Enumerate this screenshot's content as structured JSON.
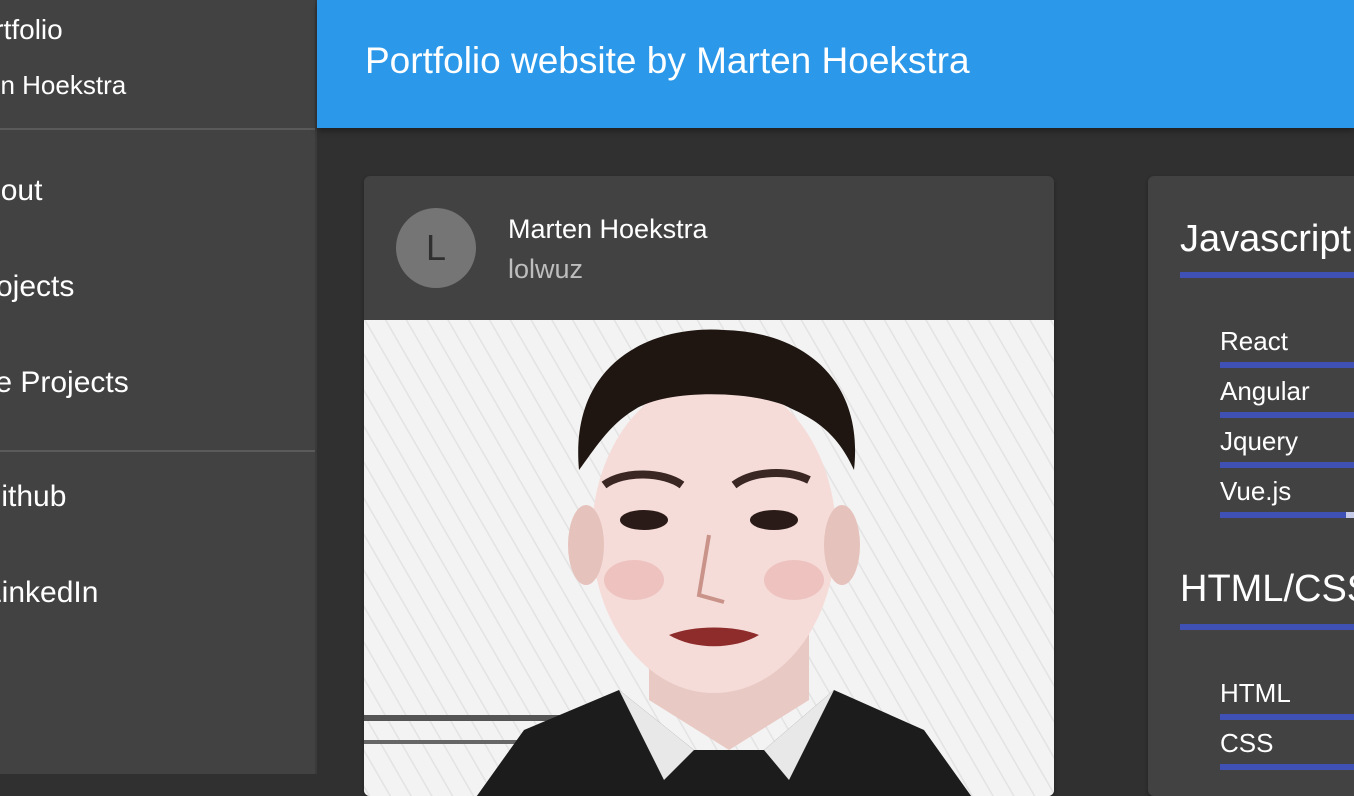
{
  "drawer": {
    "title": "Portfolio",
    "subtitle": "Marten Hoekstra",
    "items": [
      {
        "label": "About"
      },
      {
        "label": "Projects"
      },
      {
        "label": "Live Projects"
      },
      {
        "label": "Github"
      },
      {
        "label": "LinkedIn"
      }
    ]
  },
  "appbar": {
    "title": "Portfolio website by Marten Hoekstra"
  },
  "profile": {
    "avatar_letter": "L",
    "name": "Marten Hoekstra",
    "handle": "lolwuz"
  },
  "skills": {
    "javascript": {
      "title": "Javascript",
      "items": [
        {
          "label": "React",
          "level": 100
        },
        {
          "label": "Angular",
          "level": 100
        },
        {
          "label": "Jquery",
          "level": 100
        },
        {
          "label": "Vue.js",
          "level": 63
        }
      ]
    },
    "htmlcss": {
      "title": "HTML/CSS",
      "items": [
        {
          "label": "HTML",
          "level": 100
        },
        {
          "label": "CSS",
          "level": 100
        }
      ]
    }
  },
  "colors": {
    "appbar": "#2b98ea",
    "drawer": "#424242",
    "background": "#303030",
    "skill_bar": "#3f51b5",
    "skill_track": "#c5cae9"
  }
}
